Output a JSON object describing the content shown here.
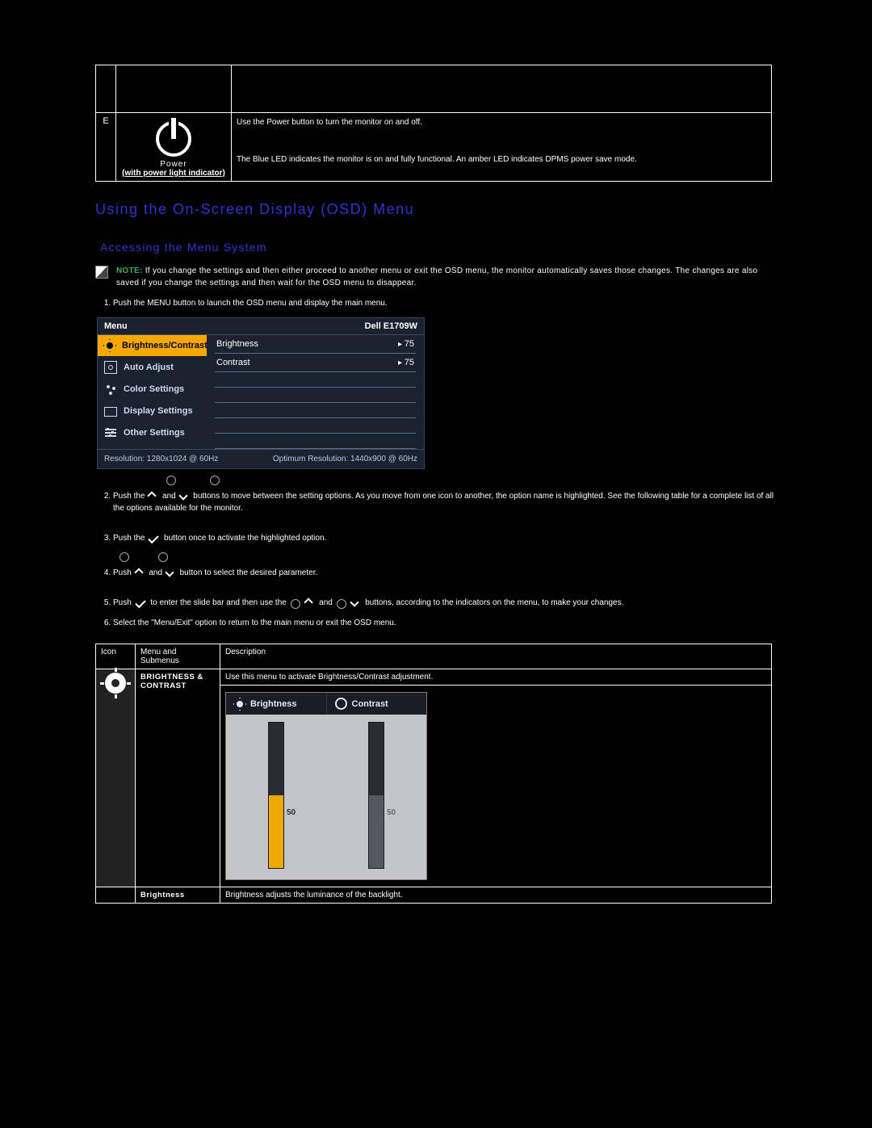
{
  "power_row": {
    "letter": "E",
    "icon_caption1": "Power",
    "icon_caption2": "(with power light indicator)",
    "desc_line1": "Use the Power button to turn the monitor on and off.",
    "desc_line2": "The Blue LED indicates the monitor is on and fully functional. An amber LED indicates DPMS power save mode."
  },
  "headings": {
    "main": "Using the On-Screen Display (OSD) Menu",
    "sub": "Accessing the Menu System"
  },
  "note": {
    "label": "NOTE:",
    "text": "If you change the settings and then either proceed to another menu or exit the OSD menu, the monitor automatically saves those changes. The changes are also saved if you change the settings and then wait for the OSD menu to disappear."
  },
  "steps": {
    "s1": "Push the MENU button to launch the OSD menu and display the main menu.",
    "s2a": "Push the ",
    "s2b": " and ",
    "s2c": " buttons to move between the setting options. As you move from one icon to another, the option name is highlighted. See the following table for a complete list of all the options available for the monitor.",
    "s3a": "Push the ",
    "s3b": " button once to activate the highlighted option.",
    "s4a": "Push ",
    "s4b": " and ",
    "s4c": " button to select the desired parameter.",
    "s5a": "Push ",
    "s5b": " to enter the slide bar and then use the ",
    "s5c": " and ",
    "s5d": " buttons, according to the indicators on the menu, to make your changes.",
    "s6": "Select the \"Menu/Exit\" option to return to the main menu or exit the OSD menu."
  },
  "osd": {
    "title_left": "Menu",
    "title_right": "Dell E1709W",
    "nav": {
      "brightness_contrast": "Brightness/Contrast",
      "auto_adjust": "Auto Adjust",
      "color_settings": "Color Settings",
      "display_settings": "Display Settings",
      "other_settings": "Other Settings"
    },
    "lines": {
      "brightness_label": "Brightness",
      "brightness_value": "75",
      "contrast_label": "Contrast",
      "contrast_value": "75"
    },
    "footer_left": "Resolution: 1280x1024 @ 60Hz",
    "footer_right": "Optimum Resolution: 1440x900 @ 60Hz"
  },
  "desc_table": {
    "h_icon": "Icon",
    "h_menu": "Menu and Submenus",
    "h_desc": "Description",
    "row1_menu": "BRIGHTNESS & CONTRAST",
    "row1_desc": "Use this menu to activate Brightness/Contrast adjustment.",
    "row2_menu": "Brightness",
    "row2_desc": "Brightness adjusts the luminance of the backlight."
  },
  "bcp": {
    "tab_brightness": "Brightness",
    "tab_contrast": "Contrast",
    "brightness_value": "50",
    "contrast_value": "50"
  },
  "chart_data": [
    {
      "type": "bar",
      "title": "Brightness",
      "categories": [
        "Brightness"
      ],
      "values": [
        50
      ],
      "ylim": [
        0,
        100
      ],
      "xlabel": "",
      "ylabel": ""
    },
    {
      "type": "bar",
      "title": "Contrast",
      "categories": [
        "Contrast"
      ],
      "values": [
        50
      ],
      "ylim": [
        0,
        100
      ],
      "xlabel": "",
      "ylabel": ""
    }
  ]
}
